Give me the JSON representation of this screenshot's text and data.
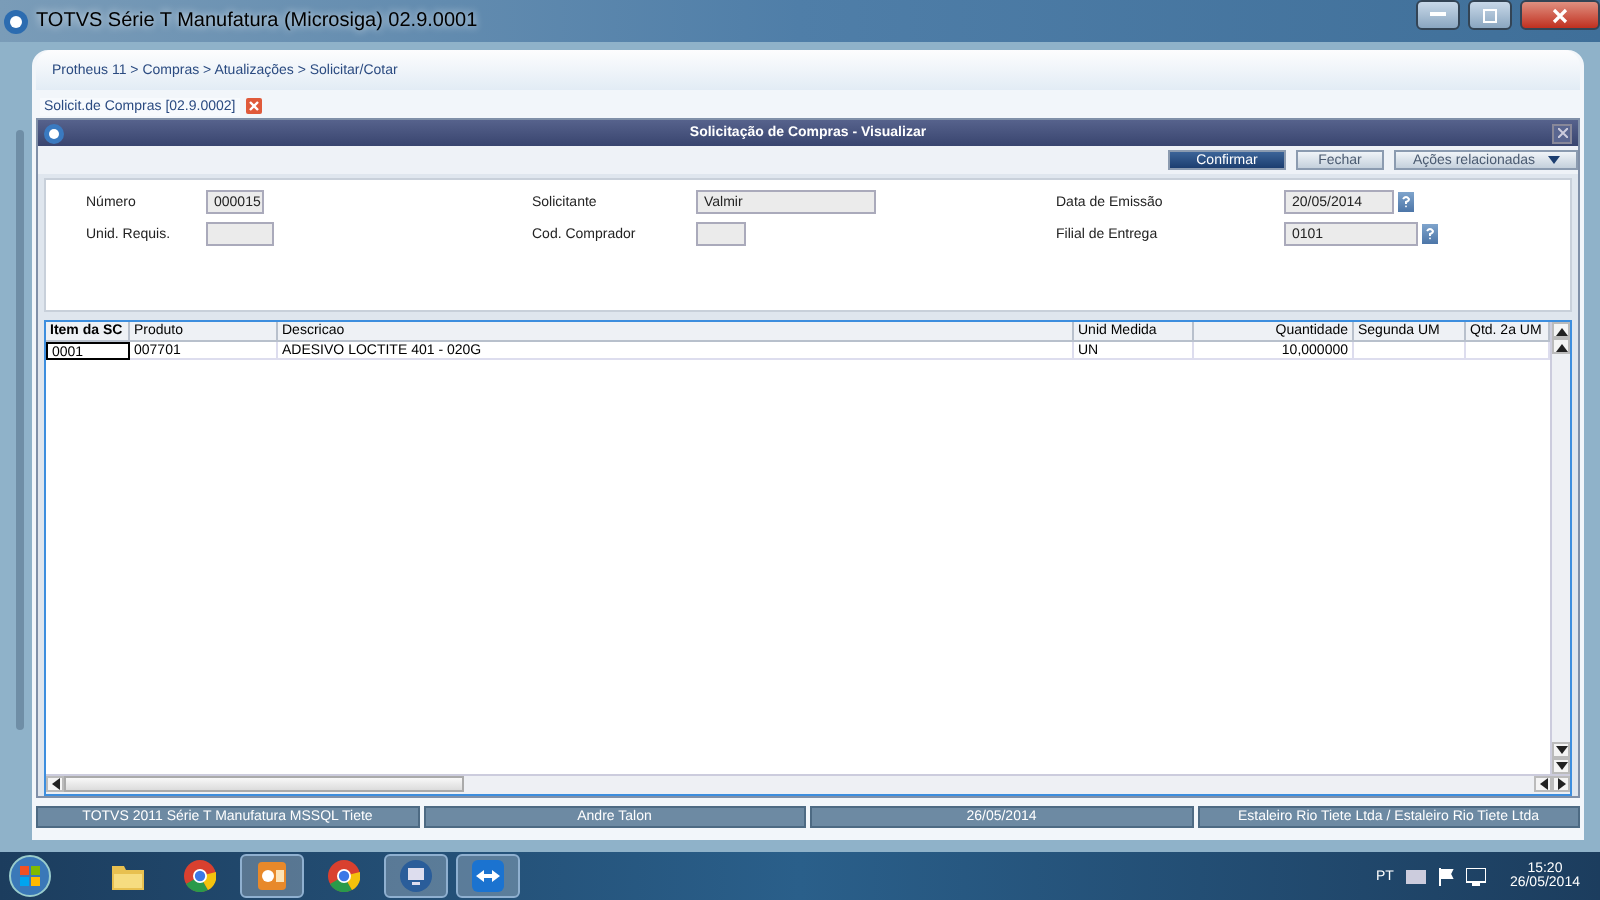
{
  "window": {
    "title": "TOTVS Série T Manufatura (Microsiga) 02.9.0001"
  },
  "breadcrumb": "Protheus 11 > Compras  > Atualizações > Solicitar/Cotar",
  "tab": {
    "label": "Solicit.de Compras [02.9.0002]"
  },
  "dialog": {
    "title": "Solicitação de Compras - Visualizar",
    "buttons": [
      {
        "label": "Confirmar",
        "kind": "primary"
      },
      {
        "label": "Fechar",
        "kind": "normal"
      },
      {
        "label": "Ações relacionadas",
        "kind": "dropdown"
      }
    ],
    "fields": [
      {
        "label": "Número",
        "value": "000015",
        "lookup": false
      },
      {
        "label": "Solicitante",
        "value": "Valmir",
        "lookup": false
      },
      {
        "label": "Data de Emissão",
        "value": "20/05/2014",
        "lookup": true
      },
      {
        "label": "Unid. Requis.",
        "lookup": false
      },
      {
        "label": "Cod. Comprador",
        "lookup": false
      },
      {
        "label": "Filial de Entrega",
        "value": "0101",
        "lookup": true
      }
    ],
    "table": {
      "columns": [
        {
          "label": "Item da SC"
        },
        {
          "label": "Produto"
        },
        {
          "label": "Descricao"
        },
        {
          "label": "Unid Medida"
        },
        {
          "label": "Quantidade"
        },
        {
          "label": "Segunda UM"
        },
        {
          "label": "Qtd. 2a UM"
        }
      ],
      "rows": [
        {
          "cells": [
            "0001",
            "007701",
            "ADESIVO LOCTITE 401 - 020G",
            "UN",
            "10,000000",
            "",
            ""
          ]
        }
      ]
    }
  },
  "status_bar": [
    "TOTVS 2011 Série T Manufatura MSSQL Tiete",
    "Andre Talon",
    "26/05/2014",
    "Estaleiro Rio Tiete Ltda / Estaleiro Rio Tiete Ltda"
  ],
  "taskbar": {
    "apps": [
      {
        "kind": "folder",
        "active": false
      },
      {
        "kind": "chrome",
        "active": false
      },
      {
        "kind": "outlook",
        "active": true
      },
      {
        "kind": "chrome",
        "active": false
      },
      {
        "kind": "remote",
        "active": true
      },
      {
        "kind": "teamviewer",
        "active": true
      }
    ],
    "language": "PT",
    "time": "15:20",
    "date": "26/05/2014"
  }
}
